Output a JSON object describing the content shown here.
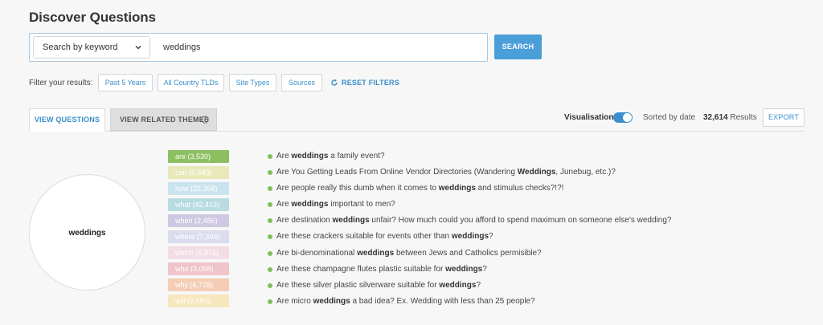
{
  "page": {
    "title": "Discover Questions"
  },
  "search": {
    "mode_label": "Search by keyword",
    "value": "weddings",
    "button_label": "SEARCH"
  },
  "filters": {
    "label": "Filter your results:",
    "chips": [
      "Past 5 Years",
      "All Country TLDs",
      "Site Types",
      "Sources"
    ],
    "reset_label": "RESET FILTERS"
  },
  "tabs": {
    "active_label": "VIEW QUESTIONS",
    "inactive_label": "VIEW RELATED THEMES"
  },
  "toolbar": {
    "visualisation_label": "Visualisation",
    "visualisation_on": true,
    "sort_label": "Sorted by date",
    "results_count": "32,614",
    "results_suffix": "Results",
    "export_label": "EXPORT"
  },
  "visual": {
    "center_label": "weddings"
  },
  "tags": [
    {
      "label": "are (3,530)",
      "color": "#8cbf5f"
    },
    {
      "label": "can (9,583)",
      "color": "#e8e9b9"
    },
    {
      "label": "how (25,358)",
      "color": "#c9e4ee"
    },
    {
      "label": "what (42,413)",
      "color": "#b8dbe2"
    },
    {
      "label": "when (2,486)",
      "color": "#cfc8e3"
    },
    {
      "label": "where (7,394)",
      "color": "#dcdcef"
    },
    {
      "label": "which (6,871)",
      "color": "#f3dde5"
    },
    {
      "label": "who (3,088)",
      "color": "#efc4ca"
    },
    {
      "label": "why (6,728)",
      "color": "#f4cdb4"
    },
    {
      "label": "will (2,583)",
      "color": "#f7e7bd"
    }
  ],
  "questions": [
    {
      "before": "Are ",
      "bold": "weddings",
      "after": " a family event?"
    },
    {
      "before": "Are You Getting Leads From Online Vendor Directories (Wandering ",
      "bold": "Weddings",
      "after": ", Junebug, etc.)?"
    },
    {
      "before": "Are people really this dumb when it comes to ",
      "bold": "weddings",
      "after": " and stimulus checks?!?!"
    },
    {
      "before": "Are ",
      "bold": "weddings",
      "after": " important to men?"
    },
    {
      "before": "Are destination ",
      "bold": "weddings",
      "after": " unfair? How much could you afford to spend maximum on someone else's wedding?"
    },
    {
      "before": "Are these crackers suitable for events other than ",
      "bold": "weddings",
      "after": "?"
    },
    {
      "before": "Are bi-denominational ",
      "bold": "weddings",
      "after": " between Jews and Catholics permisible?"
    },
    {
      "before": "Are these champagne flutes plastic suitable for ",
      "bold": "weddings",
      "after": "?"
    },
    {
      "before": "Are these silver plastic silverware suitable for ",
      "bold": "weddings",
      "after": "?"
    },
    {
      "before": "Are micro ",
      "bold": "weddings",
      "after": " a bad idea? Ex. Wedding with less than 25 people?"
    }
  ]
}
